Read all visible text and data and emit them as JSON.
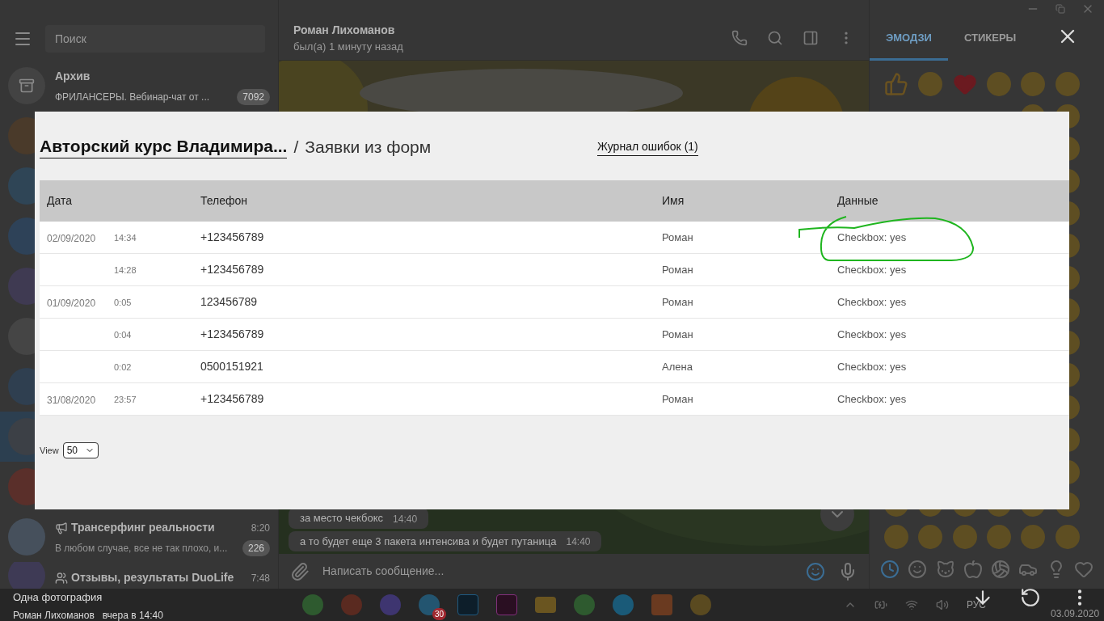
{
  "sidebar": {
    "search": {
      "placeholder": "Поиск"
    },
    "chats": [
      {
        "kind": "archive",
        "name": "Архив",
        "preview": "ФРИЛАНСЕРЫ. Вебинар-чат от ...",
        "badge": "7092",
        "selected": false
      },
      {
        "kind": "covered",
        "selected": false
      },
      {
        "kind": "covered",
        "selected": false
      },
      {
        "kind": "covered",
        "selected": false
      },
      {
        "kind": "covered",
        "selected": false
      },
      {
        "kind": "covered",
        "selected": false
      },
      {
        "kind": "covered",
        "selected": false
      },
      {
        "kind": "covered",
        "selected": true
      },
      {
        "kind": "covered",
        "selected": false
      },
      {
        "kind": "channel",
        "name": "Трансерфинг реальности",
        "time": "8:20",
        "preview": "В любом случае, все не так плохо, и...",
        "badge": "226",
        "selected": false
      },
      {
        "kind": "group",
        "name": "Отзывы, результаты DuoLife",
        "time": "7:48",
        "selected": false
      }
    ]
  },
  "chat": {
    "name": "Роман Лихоманов",
    "status": "был(а) 1 минуту назад",
    "messages": [
      {
        "text": "за место чекбокс",
        "time": "14:40"
      },
      {
        "text": "а то будет еще 3 пакета интенсива и будет путаница",
        "time": "14:40"
      }
    ],
    "input": {
      "placeholder": "Написать сообщение..."
    }
  },
  "emoji_panel": {
    "tabs": [
      {
        "label": "ЭМОДЗИ",
        "selected": true
      },
      {
        "label": "СТИКЕРЫ",
        "selected": false
      }
    ]
  },
  "photo": {
    "breadcrumb": {
      "parent": "Авторский курс Владимира...",
      "separator": "/",
      "current": "Заявки из форм"
    },
    "error_log": "Журнал ошибок (1)",
    "table": {
      "columns": [
        "Дата",
        "Телефон",
        "Имя",
        "Данные"
      ],
      "rows": [
        {
          "date": "02/09/2020",
          "time": "14:34",
          "phone": "+123456789",
          "name": "Роман",
          "data": "Checkbox: yes"
        },
        {
          "time": "14:28",
          "phone": "+123456789",
          "name": "Роман",
          "data": "Checkbox: yes"
        },
        {
          "date": "01/09/2020",
          "time": "0:05",
          "phone": "123456789",
          "name": "Роман",
          "data": "Checkbox: yes"
        },
        {
          "time": "0:04",
          "phone": "+123456789",
          "name": "Роман",
          "data": "Checkbox: yes"
        },
        {
          "time": "0:02",
          "phone": "0500151921",
          "name": "Алена",
          "data": "Checkbox: yes"
        },
        {
          "date": "31/08/2020",
          "time": "23:57",
          "phone": "+123456789",
          "name": "Роман",
          "data": "Checkbox: yes"
        }
      ]
    },
    "view": {
      "label": "View",
      "value": "50"
    }
  },
  "viewer": {
    "title": "Одна фотография",
    "author": "Роман Лихоманов",
    "date": "вчера в 14:40"
  },
  "taskbar": {
    "telegram_badge": "30",
    "language": "РУС",
    "date": "03.09.2020"
  }
}
